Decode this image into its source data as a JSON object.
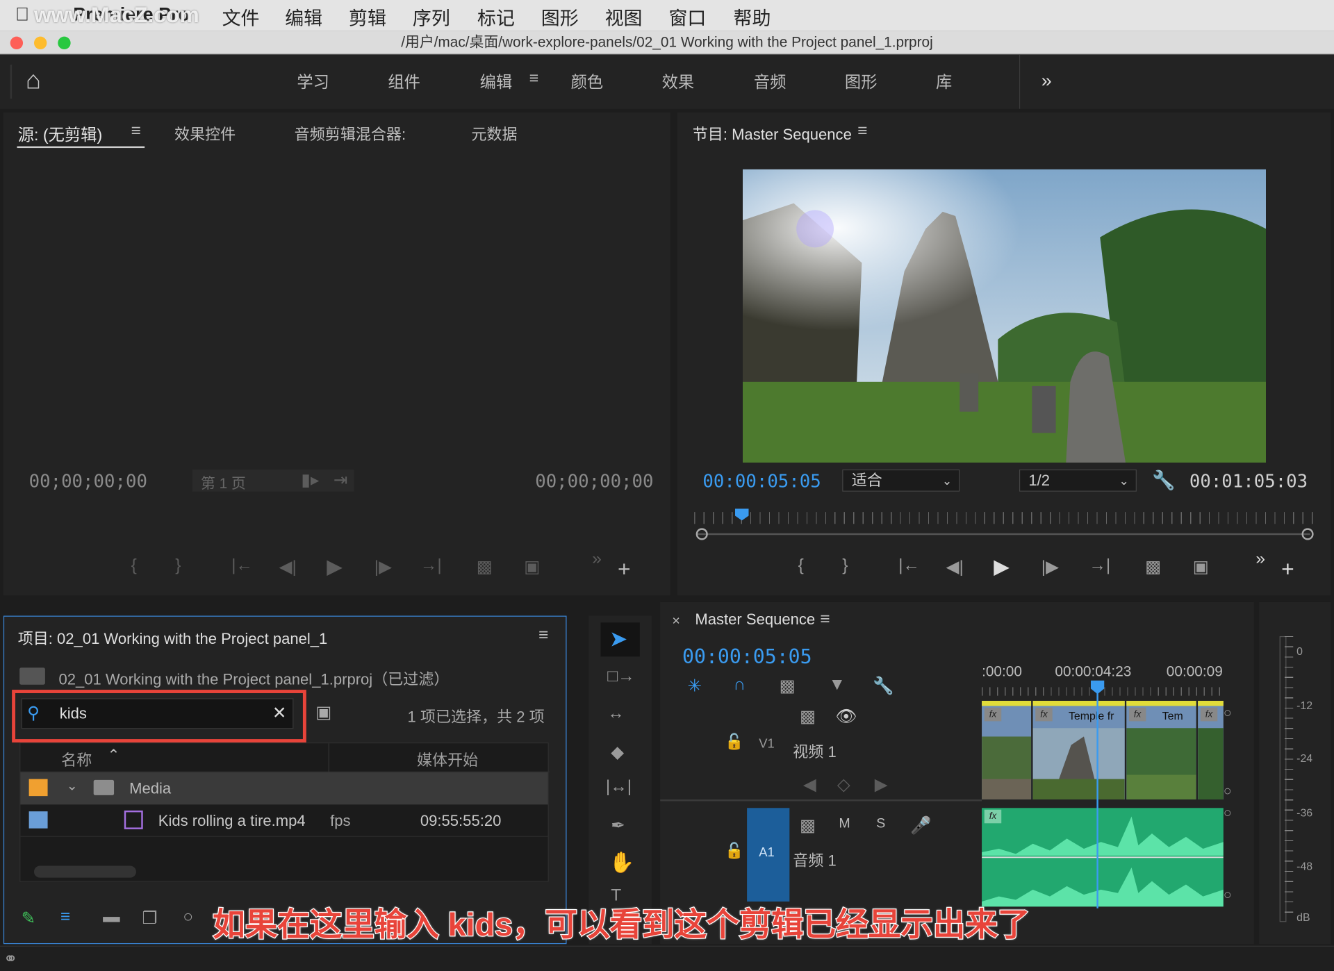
{
  "menubar": {
    "app_name": "Premiere Pro",
    "watermark": "www.MacZ.com",
    "items": [
      "文件",
      "编辑",
      "剪辑",
      "序列",
      "标记",
      "图形",
      "视图",
      "窗口",
      "帮助"
    ]
  },
  "titlebar": {
    "path": "/用户/mac/桌面/work-explore-panels/02_01 Working with the Project panel_1.prproj"
  },
  "workspaces": {
    "items": [
      "学习",
      "组件",
      "编辑",
      "颜色",
      "效果",
      "音频",
      "图形",
      "库"
    ],
    "active": "编辑",
    "more": "»"
  },
  "source_panel": {
    "tabs": [
      "源: (无剪辑)",
      "效果控件",
      "音频剪辑混合器:",
      "元数据"
    ],
    "timecode_left": "00;00;00;00",
    "timecode_right": "00;00;00;00",
    "page_label": "第 1 页"
  },
  "program_panel": {
    "title": "节目: Master Sequence",
    "timecode_current": "00:00:05:05",
    "zoom_select": "适合",
    "resolution_select": "1/2",
    "timecode_duration": "00:01:05:03"
  },
  "project_panel": {
    "title": "项目: 02_01 Working with the Project panel_1",
    "file_label": "02_01 Working with the Project panel_1.prproj（已过滤）",
    "search_value": "kids",
    "selection_status": "1 项已选择，共 2 项",
    "columns": [
      "名称",
      "媒体开始"
    ],
    "rows": [
      {
        "name": "Media",
        "fps": "",
        "start": "",
        "color": "#f0a030",
        "type": "folder"
      },
      {
        "name": "Kids rolling a tire.mp4",
        "fps": "fps",
        "start": "09:55:55:20",
        "color": "#6a9ed8",
        "type": "clip"
      }
    ]
  },
  "timeline": {
    "title": "Master Sequence",
    "timecode": "00:00:05:05",
    "ruler": [
      ":00:00",
      "00:00:04:23",
      "00:00:09"
    ],
    "video_track": {
      "id": "V1",
      "name": "视频 1"
    },
    "audio_track": {
      "id": "A1",
      "name": "音频 1",
      "buttons": [
        "M",
        "S"
      ]
    },
    "clips": [
      "Temple fr",
      "Tem"
    ]
  },
  "meter": {
    "labels": [
      "0",
      "-12",
      "-24",
      "-36",
      "-48",
      "dB"
    ]
  },
  "subtitle": "如果在这里输入 kids，可以看到这个剪辑已经显示出来了",
  "colors": {
    "accent": "#3a9bf0",
    "highlight": "#e8443a",
    "clip_video": "#6f8fb6",
    "clip_audio": "#2ec48a"
  }
}
